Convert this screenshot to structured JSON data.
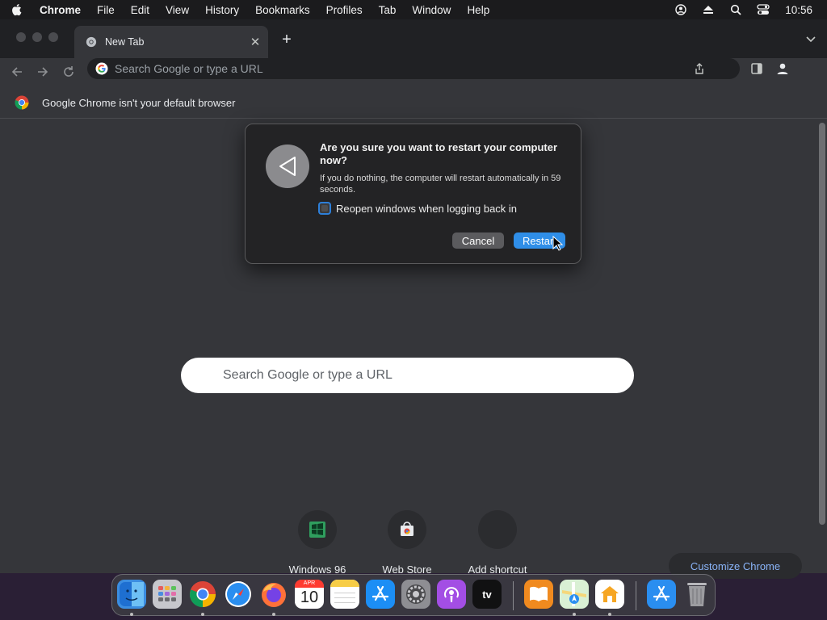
{
  "menubar": {
    "app": "Chrome",
    "items": [
      "File",
      "Edit",
      "View",
      "History",
      "Bookmarks",
      "Profiles",
      "Tab",
      "Window",
      "Help"
    ],
    "clock": "10:56",
    "status_icons": [
      "user-icon",
      "eject-icon",
      "spotlight-icon",
      "control-center-icon"
    ]
  },
  "tab": {
    "title": "New Tab"
  },
  "omnibox": {
    "placeholder": "Search Google or type a URL"
  },
  "infobar": {
    "text": "Google Chrome isn't your default browser"
  },
  "ntp": {
    "search_placeholder": "Search Google or type a URL",
    "shortcuts": [
      {
        "label": "Windows 96",
        "icon": "windows96-icon"
      },
      {
        "label": "Web Store",
        "icon": "web-store-icon"
      },
      {
        "label": "Add shortcut",
        "icon": "add-icon"
      }
    ],
    "customize": "Customize Chrome"
  },
  "dialog": {
    "title": "Are you sure you want to restart your computer now?",
    "message": "If you do nothing, the computer will restart automatically in 59 seconds.",
    "checkbox_label": "Reopen windows when logging back in",
    "checkbox_checked": false,
    "cancel": "Cancel",
    "restart": "Restart"
  },
  "dock": {
    "apps": [
      "finder-icon",
      "launchpad-icon",
      "chrome-icon",
      "safari-icon",
      "firefox-icon",
      "calendar-icon",
      "notes-icon",
      "app-store-icon",
      "system-settings-icon",
      "podcasts-icon",
      "apple-tv-icon",
      "books-icon",
      "maps-icon",
      "home-icon",
      "downloads-icon",
      "trash-icon"
    ],
    "calendar_month": "APR",
    "calendar_day": "10",
    "tv_label": "tv"
  }
}
